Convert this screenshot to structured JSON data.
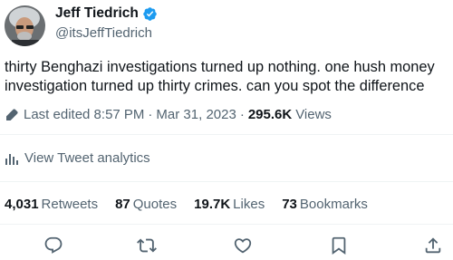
{
  "author": {
    "display_name": "Jeff Tiedrich",
    "handle": "@itsJeffTiedrich",
    "verified_color": "#1d9bf0"
  },
  "tweet": {
    "text": "thirty Benghazi investigations turned up nothing. one hush money investigation turned up thirty crimes. can you spot the difference",
    "edited_label": "Last edited 8:57 PM",
    "date": "Mar 31, 2023",
    "separator": "·",
    "views_count": "295.6K",
    "views_label": "Views"
  },
  "analytics": {
    "label": "View Tweet analytics"
  },
  "stats": [
    {
      "count": "4,031",
      "label": "Retweets"
    },
    {
      "count": "87",
      "label": "Quotes"
    },
    {
      "count": "19.7K",
      "label": "Likes"
    },
    {
      "count": "73",
      "label": "Bookmarks"
    }
  ],
  "actions": [
    {
      "icon": "reply-icon"
    },
    {
      "icon": "retweet-icon"
    },
    {
      "icon": "like-icon"
    },
    {
      "icon": "bookmark-icon"
    },
    {
      "icon": "share-icon"
    }
  ]
}
